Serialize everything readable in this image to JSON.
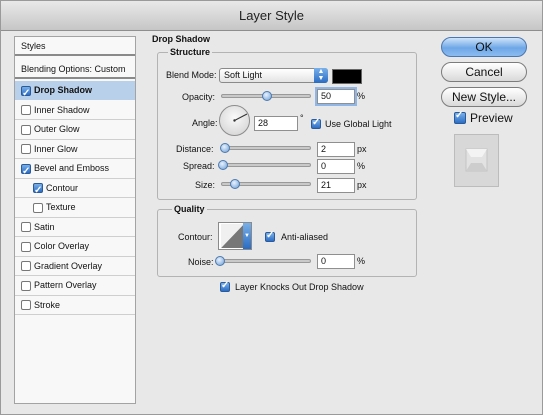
{
  "window": {
    "title": "Layer Style"
  },
  "sidebar": {
    "header": "Styles",
    "blending": "Blending Options: Custom",
    "items": [
      {
        "label": "Drop Shadow",
        "checked": true,
        "selected": true,
        "indent": false
      },
      {
        "label": "Inner Shadow",
        "checked": false,
        "selected": false,
        "indent": false
      },
      {
        "label": "Outer Glow",
        "checked": false,
        "selected": false,
        "indent": false
      },
      {
        "label": "Inner Glow",
        "checked": false,
        "selected": false,
        "indent": false
      },
      {
        "label": "Bevel and Emboss",
        "checked": true,
        "selected": false,
        "indent": false
      },
      {
        "label": "Contour",
        "checked": true,
        "selected": false,
        "indent": true
      },
      {
        "label": "Texture",
        "checked": false,
        "selected": false,
        "indent": true
      },
      {
        "label": "Satin",
        "checked": false,
        "selected": false,
        "indent": false
      },
      {
        "label": "Color Overlay",
        "checked": false,
        "selected": false,
        "indent": false
      },
      {
        "label": "Gradient Overlay",
        "checked": false,
        "selected": false,
        "indent": false
      },
      {
        "label": "Pattern Overlay",
        "checked": false,
        "selected": false,
        "indent": false
      },
      {
        "label": "Stroke",
        "checked": false,
        "selected": false,
        "indent": false
      }
    ]
  },
  "drop_shadow": {
    "title": "Drop Shadow",
    "structure": {
      "title": "Structure",
      "blend_mode_label": "Blend Mode:",
      "blend_mode_value": "Soft Light",
      "shadow_color": "#000000",
      "opacity_label": "Opacity:",
      "opacity_value": "50",
      "opacity_unit": "%",
      "opacity_level": 0.5,
      "angle_label": "Angle:",
      "angle_value": "28",
      "angle_unit": "°",
      "use_global_light_label": "Use Global Light",
      "use_global_light_checked": true,
      "distance_label": "Distance:",
      "distance_value": "2",
      "distance_unit": "px",
      "spread_label": "Spread:",
      "spread_value": "0",
      "spread_unit": "%",
      "size_label": "Size:",
      "size_value": "21",
      "size_unit": "px"
    },
    "quality": {
      "title": "Quality",
      "contour_label": "Contour:",
      "anti_aliased_label": "Anti-aliased",
      "anti_aliased_checked": true,
      "noise_label": "Noise:",
      "noise_value": "0",
      "noise_unit": "%"
    },
    "knockout_label": "Layer Knocks Out Drop Shadow",
    "knockout_checked": true
  },
  "buttons": {
    "ok": "OK",
    "cancel": "Cancel",
    "new_style": "New Style...",
    "preview_label": "Preview",
    "preview_checked": true
  }
}
